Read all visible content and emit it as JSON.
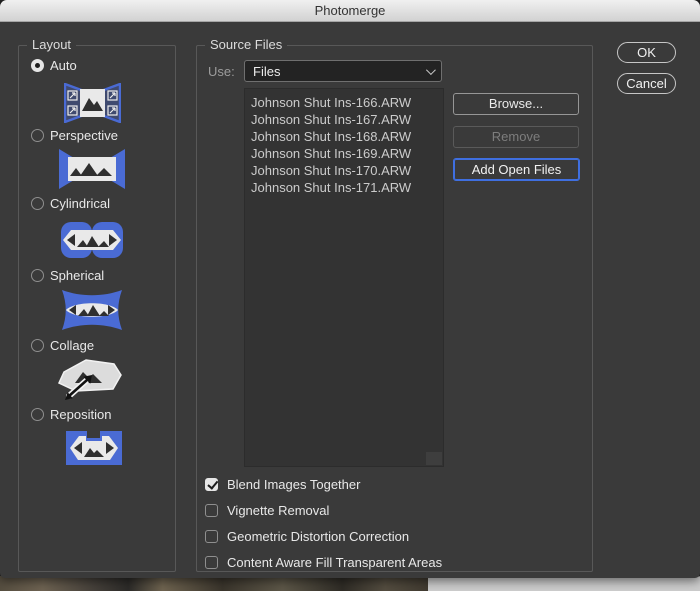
{
  "window": {
    "title": "Photomerge"
  },
  "colors": {
    "dialog_bg": "#3a3a3a",
    "accent_blue": "#4a6bd4",
    "focus_border": "#3f6fe0",
    "titlebar_bg": "#e0e0e0"
  },
  "layout_panel": {
    "label": "Layout",
    "options": [
      {
        "label": "Auto",
        "selected": true
      },
      {
        "label": "Perspective",
        "selected": false
      },
      {
        "label": "Cylindrical",
        "selected": false
      },
      {
        "label": "Spherical",
        "selected": false
      },
      {
        "label": "Collage",
        "selected": false
      },
      {
        "label": "Reposition",
        "selected": false
      }
    ]
  },
  "source_files": {
    "label": "Source Files",
    "use_label": "Use:",
    "use_selected": "Files",
    "file_list": [
      "Johnson Shut Ins-166.ARW",
      "Johnson Shut Ins-167.ARW",
      "Johnson Shut Ins-168.ARW",
      "Johnson Shut Ins-169.ARW",
      "Johnson Shut Ins-170.ARW",
      "Johnson Shut Ins-171.ARW"
    ],
    "buttons": {
      "browse": "Browse...",
      "remove": "Remove",
      "add_open_files": "Add Open Files"
    },
    "checkboxes": [
      {
        "label": "Blend Images Together",
        "checked": true
      },
      {
        "label": "Vignette Removal",
        "checked": false
      },
      {
        "label": "Geometric Distortion Correction",
        "checked": false
      },
      {
        "label": "Content Aware Fill Transparent Areas",
        "checked": false
      }
    ]
  },
  "action_buttons": {
    "ok": "OK",
    "cancel": "Cancel"
  }
}
